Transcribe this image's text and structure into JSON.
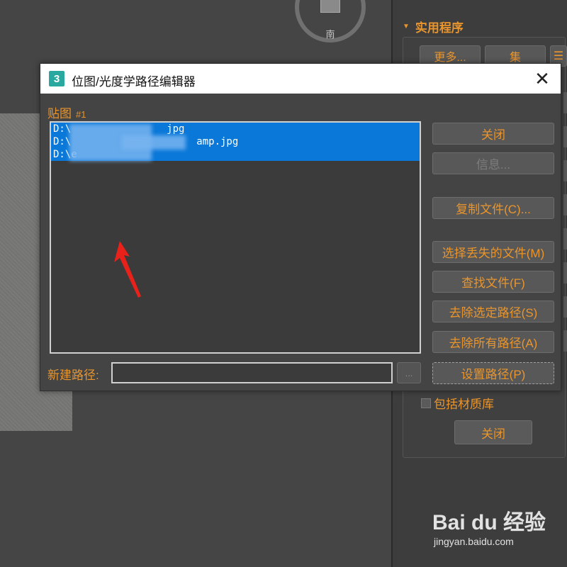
{
  "viewport": {
    "viewcube_label": "南"
  },
  "command_panel": {
    "section_title": "实用程序",
    "more_button": "更多...",
    "sets_button": "集",
    "include_material_library": "包括材质库",
    "close_button": "关闭"
  },
  "dialog": {
    "title": "位图/光度学路径编辑器",
    "map_label": "贴图",
    "map_id": "#1",
    "paths": [
      "D:\\                jpg",
      "D:\\                     amp.jpg",
      "D:\\e"
    ],
    "buttons": {
      "close": "关闭",
      "info": "信息...",
      "copy_files": "复制文件(C)...",
      "select_missing": "选择丢失的文件(M)",
      "find_files": "查找文件(F)",
      "strip_selected": "去除选定路径(S)",
      "strip_all": "去除所有路径(A)",
      "set_path": "设置路径(P)"
    },
    "new_path_label": "新建路径:",
    "new_path_value": "",
    "browse_label": "..."
  },
  "watermark": {
    "logo": "Bai du 经验",
    "url": "jingyan.baidu.com"
  },
  "colors": {
    "accent_orange": "#e8952e",
    "selection_blue": "#0a78d8",
    "dialog_bg": "#444444",
    "app_icon": "#29a8a0"
  },
  "icons": [
    "app-3dsmax-icon",
    "close-icon",
    "arrow-annotation-icon",
    "collapse-triangle-icon"
  ]
}
